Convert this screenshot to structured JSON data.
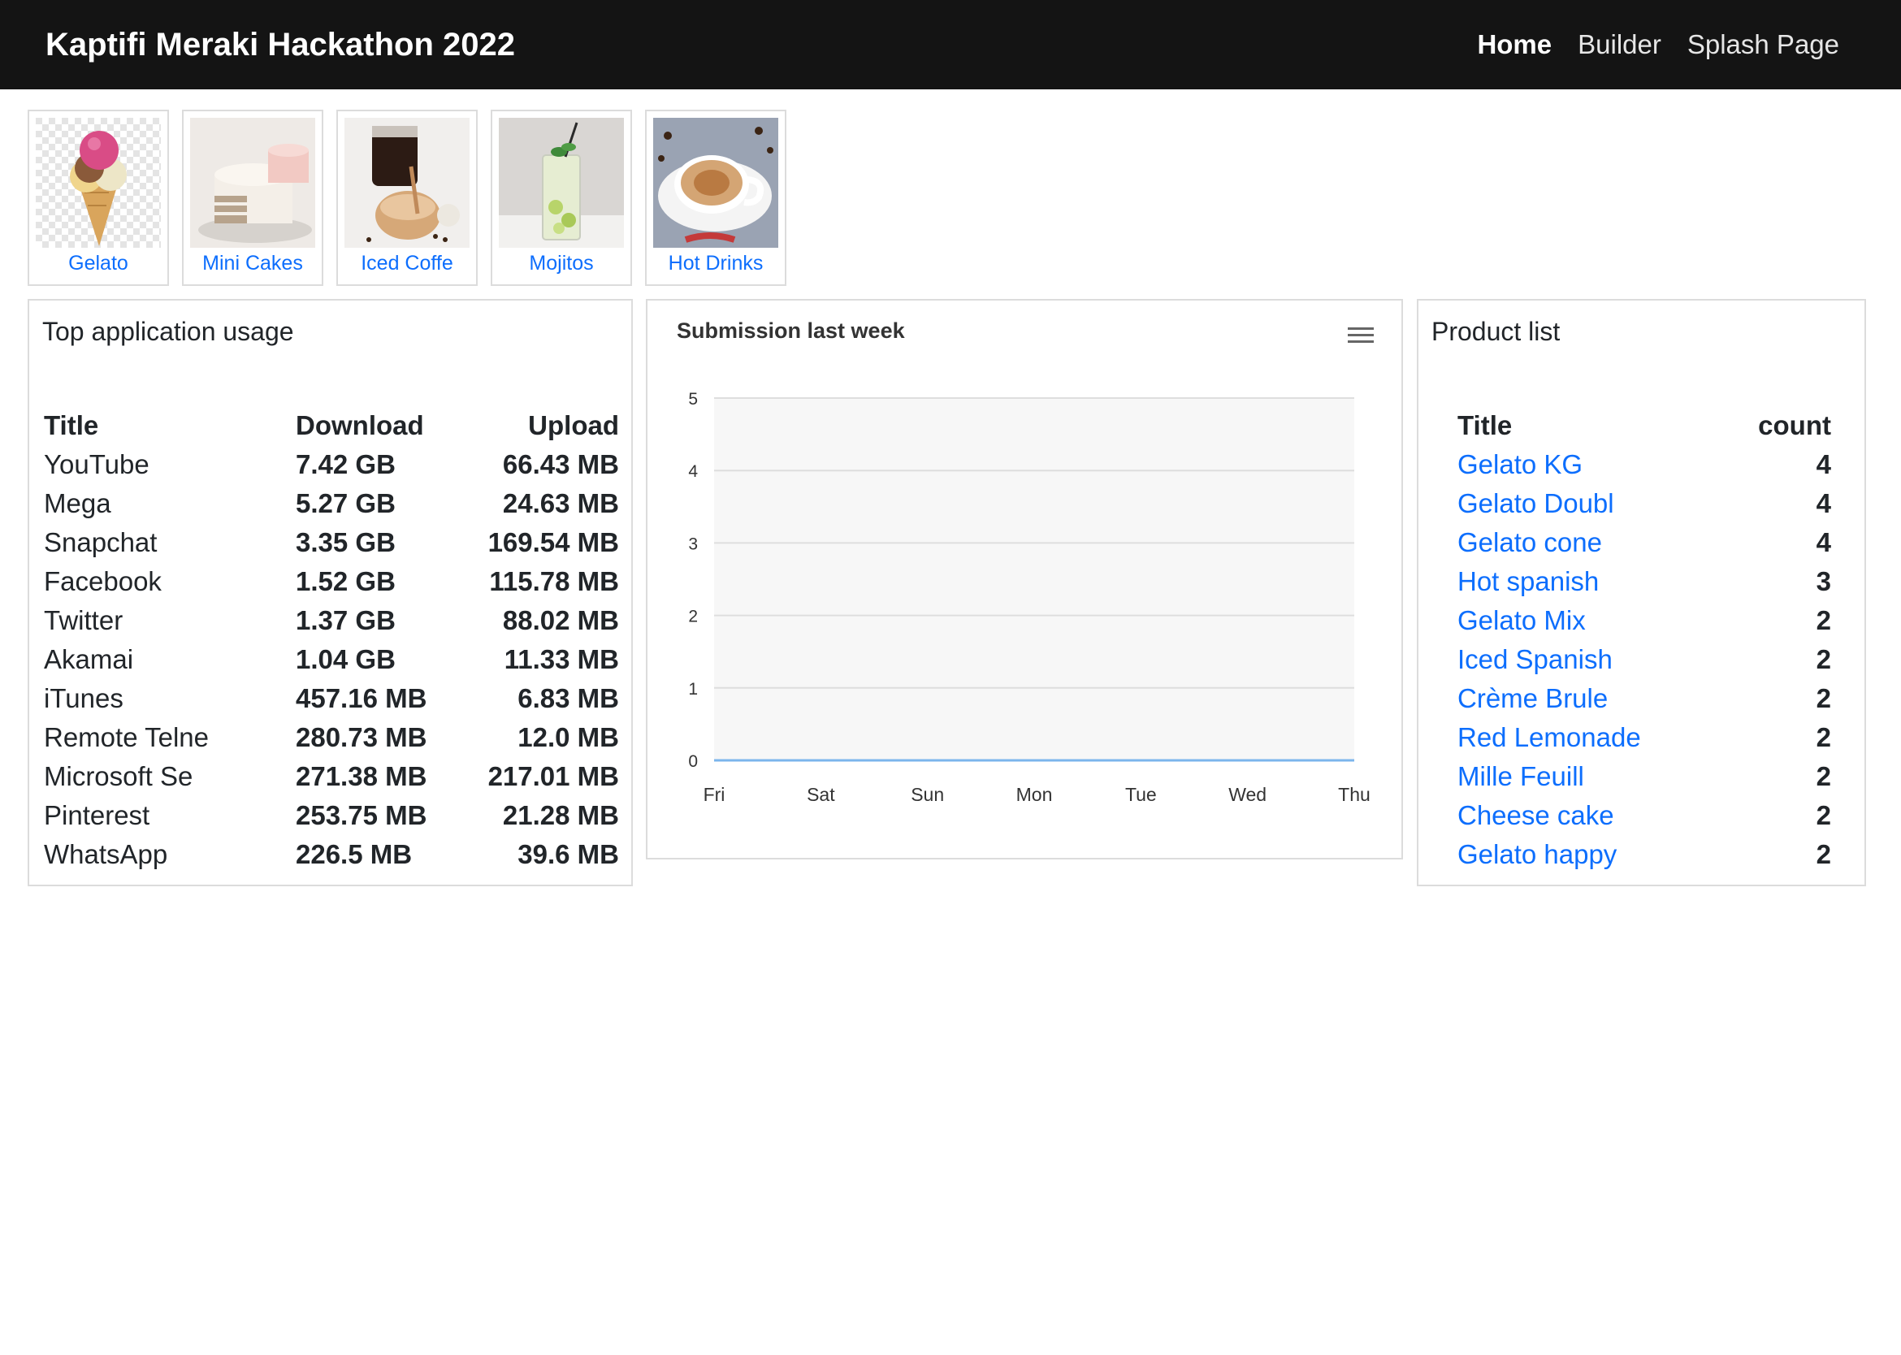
{
  "navbar": {
    "brand": "Kaptifi Meraki Hackathon 2022",
    "links": [
      {
        "label": "Home",
        "active": true
      },
      {
        "label": "Builder",
        "active": false
      },
      {
        "label": "Splash Page",
        "active": false
      }
    ]
  },
  "categories": [
    {
      "label": "Gelato",
      "icon": "ice-cream-cone"
    },
    {
      "label": "Mini Cakes",
      "icon": "cake"
    },
    {
      "label": "Iced Coffe",
      "icon": "iced-coffee"
    },
    {
      "label": "Mojitos",
      "icon": "mojito-glass"
    },
    {
      "label": "Hot Drinks",
      "icon": "coffee-cup"
    }
  ],
  "app_usage": {
    "title": "Top application usage",
    "columns": [
      "Title",
      "Download",
      "Upload"
    ],
    "rows": [
      [
        "YouTube",
        "7.42 GB",
        "66.43 MB"
      ],
      [
        "Mega",
        "5.27 GB",
        "24.63 MB"
      ],
      [
        "Snapchat",
        "3.35 GB",
        "169.54 MB"
      ],
      [
        "Facebook",
        "1.52 GB",
        "115.78 MB"
      ],
      [
        "Twitter",
        "1.37 GB",
        "88.02 MB"
      ],
      [
        "Akamai",
        "1.04 GB",
        "11.33 MB"
      ],
      [
        "iTunes",
        "457.16 MB",
        "6.83 MB"
      ],
      [
        "Remote Telne",
        "280.73 MB",
        "12.0 MB"
      ],
      [
        "Microsoft Se",
        "271.38 MB",
        "217.01 MB"
      ],
      [
        "Pinterest",
        "253.75 MB",
        "21.28 MB"
      ],
      [
        "WhatsApp",
        "226.5 MB",
        "39.6 MB"
      ]
    ]
  },
  "chart_data": {
    "type": "area",
    "title": "Submission last week",
    "categories": [
      "Fri",
      "Sat",
      "Sun",
      "Mon",
      "Tue",
      "Wed",
      "Thu"
    ],
    "series": [
      {
        "values": [
          0,
          0,
          0,
          0,
          0,
          0,
          0
        ]
      }
    ],
    "ylim": [
      0,
      5
    ],
    "yticks": [
      0,
      1,
      2,
      3,
      4,
      5
    ],
    "grid": true,
    "line_color": "#7cb5ec"
  },
  "product_list": {
    "title": "Product list",
    "columns": [
      "Title",
      "count"
    ],
    "rows": [
      [
        "Gelato KG",
        "4"
      ],
      [
        "Gelato Doubl",
        "4"
      ],
      [
        "Gelato cone",
        "4"
      ],
      [
        "Hot spanish",
        "3"
      ],
      [
        "Gelato Mix",
        "2"
      ],
      [
        "Iced Spanish",
        "2"
      ],
      [
        "Crème Brule",
        "2"
      ],
      [
        "Red Lemonade",
        "2"
      ],
      [
        "Mille Feuill",
        "2"
      ],
      [
        "Cheese cake",
        "2"
      ],
      [
        "Gelato happy",
        "2"
      ]
    ]
  },
  "colors": {
    "navbar_bg": "#141414",
    "link": "#0d6efd",
    "border": "#dcdcdc"
  }
}
